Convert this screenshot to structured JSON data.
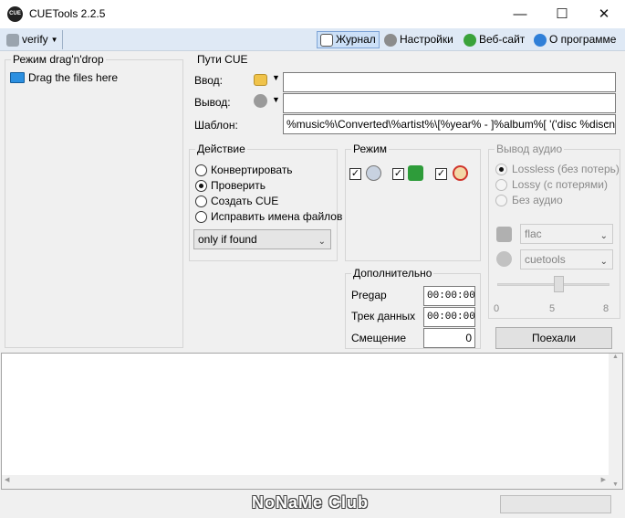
{
  "window": {
    "title": "CUETools 2.2.5",
    "icon_text": "CUE",
    "controls": [
      "—",
      "☐",
      "✕"
    ]
  },
  "toolbar": {
    "profile": "verify",
    "log_label": "Журнал",
    "settings_label": "Настройки",
    "website_label": "Веб-сайт",
    "about_label": "О программе"
  },
  "dragdrop": {
    "title": "Режим drag'n'drop",
    "item": "Drag the files here"
  },
  "paths": {
    "title": "Пути CUE",
    "input_label": "Ввод:",
    "output_label": "Вывод:",
    "template_label": "Шаблон:",
    "input_value": "",
    "output_value": "",
    "template_value": "%music%\\Converted\\%artist%\\[%year% - ]%album%[ '('disc %discn"
  },
  "action": {
    "title": "Действие",
    "options": [
      "Конвертировать",
      "Проверить",
      "Создать CUE",
      "Исправить имена файлов"
    ],
    "selected": "Проверить",
    "mode_select": "only if found"
  },
  "mode": {
    "title": "Режим",
    "icons": [
      "disc-add-icon",
      "puzzle-icon",
      "alarm-clock-icon"
    ]
  },
  "audio": {
    "title": "Вывод аудио",
    "options": [
      "Lossless (без потерь)",
      "Lossy (с потерями)",
      "Без аудио"
    ],
    "format": "flac",
    "encoder": "cuetools",
    "slider_labels": [
      "0",
      "5",
      "8"
    ],
    "slider_level": 0.55
  },
  "extra": {
    "title": "Дополнительно",
    "pregap_label": "Pregap",
    "pregap_value": "00:00:00",
    "datatrack_label": "Трек данных",
    "datatrack_value": "00:00:00",
    "offset_label": "Смещение",
    "offset_value": "0"
  },
  "go_button": "Поехали",
  "status": {
    "watermark": "NoNaMe Club"
  },
  "colors": {
    "accent": "#0078d7",
    "toolbar_bg": "#dfe9f5"
  }
}
